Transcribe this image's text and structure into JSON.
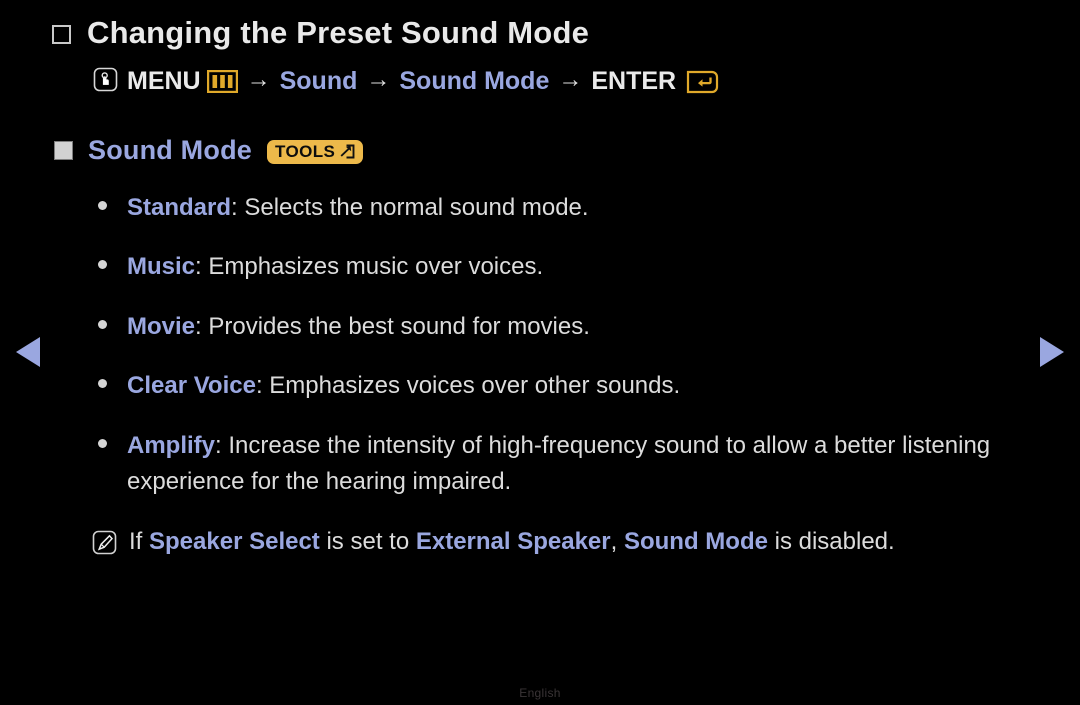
{
  "page": {
    "title": "Changing the Preset Sound Mode",
    "footer_language": "English",
    "background_color": "#000000",
    "accent_blue": "#9aa7e0",
    "accent_gold": "#edb94a",
    "body_text_color": "#dcdcdc"
  },
  "menu_path": {
    "press_icon": "press-hand-icon",
    "menu_label": "MENU",
    "menu_icon": "menu-bars-icon",
    "arrow1": "→",
    "step1": "Sound",
    "arrow2": "→",
    "step2": "Sound Mode",
    "arrow3": "→",
    "enter_label": "ENTER",
    "enter_icon": "enter-key-icon"
  },
  "section": {
    "marker": "filled-square-marker",
    "title": "Sound Mode",
    "badge": {
      "label": "TOOLS",
      "glyph": "tools-arrow-icon",
      "background": "#edb94a",
      "text_color": "#0d0d0d"
    }
  },
  "modes": [
    {
      "term": "Standard",
      "separator": ": ",
      "description": "Selects the normal sound mode."
    },
    {
      "term": "Music",
      "separator": ": ",
      "description": "Emphasizes music over voices."
    },
    {
      "term": "Movie",
      "separator": ": ",
      "description": "Provides the best sound for movies."
    },
    {
      "term": "Clear Voice",
      "separator": ": ",
      "description": "Emphasizes voices over other sounds."
    },
    {
      "term": "Amplify",
      "separator": ": ",
      "description": "Increase the intensity of high-frequency sound to allow a better listening experience for the hearing impaired."
    }
  ],
  "note": {
    "icon": "note-pen-icon",
    "prefix": "If ",
    "term1": "Speaker Select",
    "middle1": " is set to ",
    "term2": "External Speaker",
    "middle2": ", ",
    "term3": "Sound Mode",
    "suffix": " is disabled."
  },
  "navigation": {
    "prev": "previous-page-arrow",
    "next": "next-page-arrow"
  }
}
